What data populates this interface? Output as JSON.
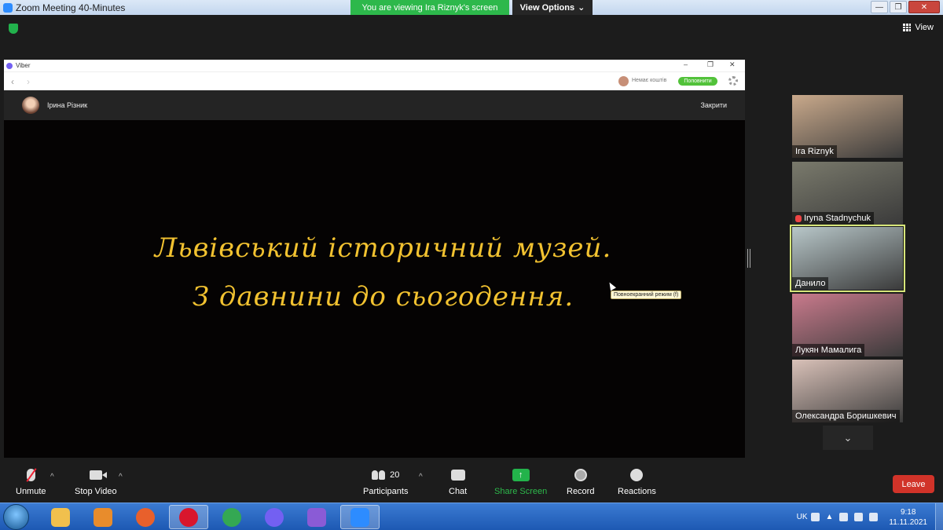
{
  "app": {
    "title": "Zoom Meeting 40-Minutes",
    "viewing_banner": "You are viewing Ira Riznyk's screen",
    "view_options": "View Options",
    "view_button": "View"
  },
  "window_controls": [
    "—",
    "❐",
    "✕"
  ],
  "shared_window": {
    "app_name": "Viber",
    "controls": [
      "–",
      "❐",
      "✕"
    ],
    "wallet_label": "Немає коштів",
    "topup_button": "Поповнити",
    "contact_name": "Ірина Різник",
    "close_label": "Закрити",
    "slide_line1": "Львівський історичний музей.",
    "slide_line2": "З давнини до сьогодення.",
    "tooltip": "Повноекранний режим (f)"
  },
  "participants": [
    {
      "name": "Ira Riznyk",
      "muted": false,
      "active": false,
      "color": "#c9a98b"
    },
    {
      "name": "Iryna Stadnychuk",
      "muted": true,
      "active": false,
      "color": "#7a7a6c"
    },
    {
      "name": "Данило",
      "muted": false,
      "active": true,
      "color": "#b8c7c9"
    },
    {
      "name": "Лукян Мамалига",
      "muted": false,
      "active": false,
      "color": "#c97a8c"
    },
    {
      "name": "Олександра Боришкевич",
      "muted": false,
      "active": false,
      "color": "#d9c1b8"
    }
  ],
  "toolbar": {
    "unmute": "Unmute",
    "stop_video": "Stop Video",
    "participants": "Participants",
    "participants_count": "20",
    "chat": "Chat",
    "share_screen": "Share Screen",
    "record": "Record",
    "reactions": "Reactions",
    "leave": "Leave"
  },
  "taskbar": {
    "language": "UK",
    "time": "9:18",
    "date": "11.11.2021",
    "apps": [
      {
        "name": "explorer",
        "color": "#f1c04d",
        "active": false
      },
      {
        "name": "media-player",
        "color": "#e88c2c",
        "active": false
      },
      {
        "name": "firefox",
        "color": "#e8602c",
        "active": false
      },
      {
        "name": "opera",
        "color": "#d8162d",
        "active": true
      },
      {
        "name": "chrome",
        "color": "#34a853",
        "active": false
      },
      {
        "name": "viber",
        "color": "#7360f2",
        "active": false
      },
      {
        "name": "visual-studio",
        "color": "#8a5bd6",
        "active": false
      },
      {
        "name": "zoom",
        "color": "#2d8cff",
        "active": true
      }
    ]
  },
  "colors": {
    "accent_green": "#2db84b",
    "leave_red": "#d13329",
    "slide_text": "#f2c230"
  }
}
